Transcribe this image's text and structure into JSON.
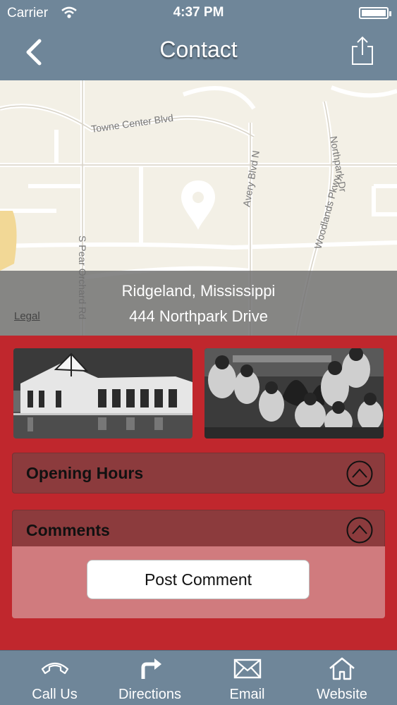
{
  "status_bar": {
    "carrier": "Carrier",
    "time": "4:37 PM",
    "battery_level": 1.0
  },
  "header": {
    "title": "Contact",
    "back_icon": "chevron-left-icon",
    "share_icon": "share-icon"
  },
  "map": {
    "city": "Ridgeland, Mississippi",
    "street": "444 Northpark Drive",
    "legal": "Legal",
    "street_labels": [
      "Towne Center Blvd",
      "Avery Blvd N",
      "Northpark Dr",
      "S Pear Orchard Rd",
      "Woodlands Pkwy"
    ],
    "pin_icon": "map-pin-icon"
  },
  "photos": [
    "church-building-photo",
    "congregation-prayer-photo"
  ],
  "sections": {
    "opening_hours": {
      "label": "Opening Hours"
    },
    "comments": {
      "label": "Comments",
      "post_button": "Post Comment"
    }
  },
  "tabs": [
    {
      "label": "Call Us",
      "icon": "phone-icon"
    },
    {
      "label": "Directions",
      "icon": "directions-arrow-icon"
    },
    {
      "label": "Email",
      "icon": "envelope-icon"
    },
    {
      "label": "Website",
      "icon": "home-icon"
    }
  ],
  "colors": {
    "header": "#6f8699",
    "background": "#c0272d",
    "accordion": "#8c3b3d",
    "comments_body": "#d07b7e"
  }
}
